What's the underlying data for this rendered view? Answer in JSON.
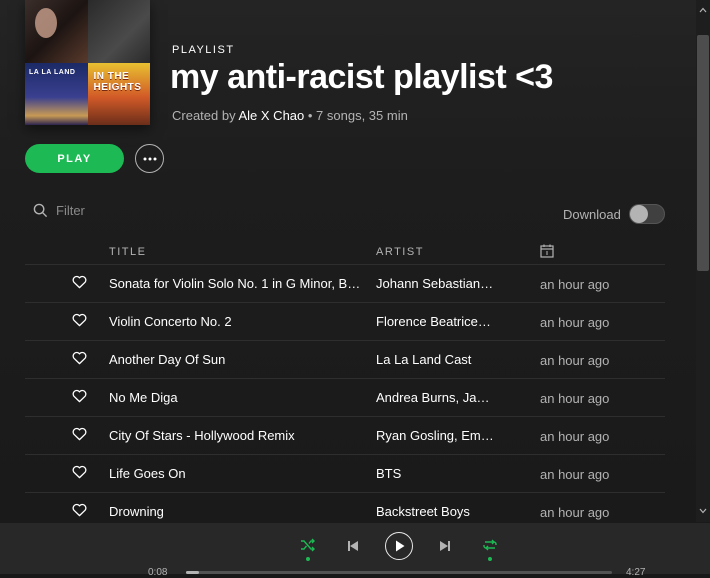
{
  "header": {
    "cover_tiles": [
      "",
      "",
      "LA LA LAND",
      "IN THE HEIGHTS"
    ],
    "eyebrow": "PLAYLIST",
    "title": "my anti-racist playlist <3",
    "created_by_prefix": "Created by ",
    "owner": "Ale X Chao",
    "stats": " • 7 songs, 35 min"
  },
  "actions": {
    "play_label": "PLAY",
    "more_icon": "more-horizontal-icon"
  },
  "filter": {
    "placeholder": "Filter"
  },
  "download": {
    "label": "Download",
    "enabled": false
  },
  "table": {
    "columns": {
      "title": "TITLE",
      "artist": "ARTIST",
      "date_icon": "calendar-icon"
    },
    "rows": [
      {
        "title": "Sonata for Violin Solo No. 1 in G Minor, B…",
        "artist": "Johann Sebastian…",
        "added": "an hour ago"
      },
      {
        "title": "Violin Concerto No. 2",
        "artist": "Florence Beatrice…",
        "added": "an hour ago"
      },
      {
        "title": "Another Day Of Sun",
        "artist": "La La Land Cast",
        "added": "an hour ago"
      },
      {
        "title": "No Me Diga",
        "artist": "Andrea Burns, Ja…",
        "added": "an hour ago"
      },
      {
        "title": "City Of Stars - Hollywood Remix",
        "artist": "Ryan Gosling, Em…",
        "added": "an hour ago"
      },
      {
        "title": "Life Goes On",
        "artist": "BTS",
        "added": "an hour ago"
      },
      {
        "title": "Drowning",
        "artist": "Backstreet Boys",
        "added": "an hour ago"
      }
    ]
  },
  "player": {
    "elapsed": "0:08",
    "duration": "4:27",
    "progress_fraction": 0.03,
    "shuffle_active": true,
    "repeat_active": true
  },
  "colors": {
    "accent": "#1db954",
    "background": "#181818",
    "player_bg": "#282828"
  }
}
